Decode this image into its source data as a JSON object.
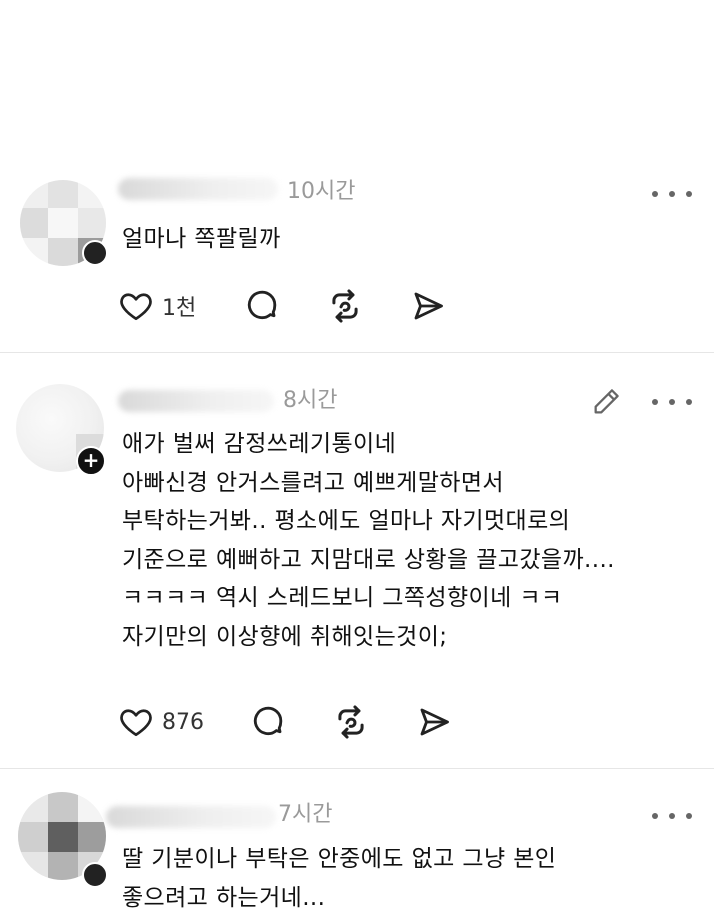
{
  "posts": [
    {
      "time": "10시간",
      "lines": [
        "얼마나 쪽팔릴까"
      ],
      "like_count": "1천"
    },
    {
      "time": "8시간",
      "lines": [
        "애가 벌써 감정쓰레기통이네",
        "아빠신경 안거스를려고 예쁘게말하면서",
        "부탁하는거봐.. 평소에도 얼마나 자기멋대로의",
        "기준으로 예뻐하고 지맘대로 상황을 끌고갔을까....",
        "ㅋㅋㅋㅋ 역시 스레드보니 그쪽성향이네 ㅋㅋ",
        "자기만의 이상향에 취해잇는것이;"
      ],
      "like_count": "876"
    },
    {
      "time": "7시간",
      "lines": [
        "딸 기분이나 부탁은 안중에도 없고 그냥 본인",
        "좋으려고 하는거네..."
      ]
    }
  ],
  "icons": {
    "like": "heart-icon",
    "reply": "comment-icon",
    "repost": "repost-icon",
    "share": "send-icon",
    "more": "more-icon",
    "edit": "pencil-icon",
    "follow": "plus-icon"
  }
}
